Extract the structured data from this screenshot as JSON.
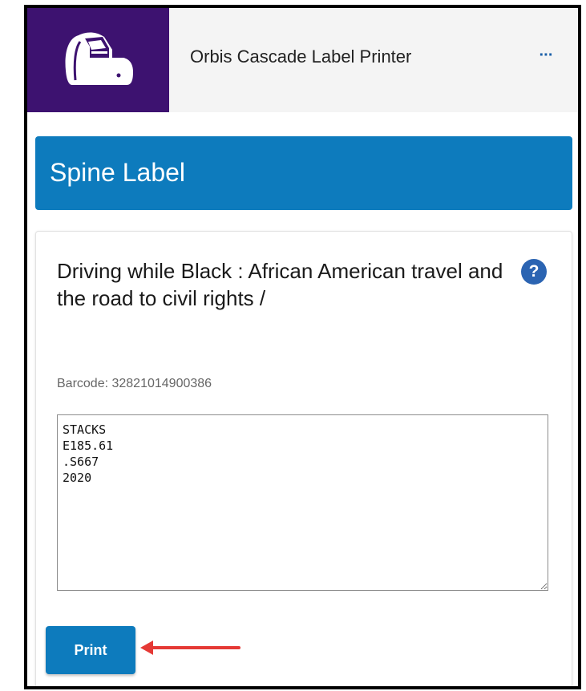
{
  "header": {
    "app_title": "Orbis Cascade Label Printer",
    "more_label": "···",
    "logo_color": "#3d1270",
    "icon": "label-printer-icon"
  },
  "section": {
    "title": "Spine Label",
    "color": "#0d7bbd"
  },
  "item": {
    "title": "Driving while Black : African American travel and the road to civil rights /",
    "help_label": "?",
    "barcode": "Barcode: 32821014900386",
    "label_text": "STACKS\nE185.61\n.S667\n2020"
  },
  "actions": {
    "print_label": "Print"
  },
  "annotation": {
    "arrow_color": "#e53935"
  }
}
